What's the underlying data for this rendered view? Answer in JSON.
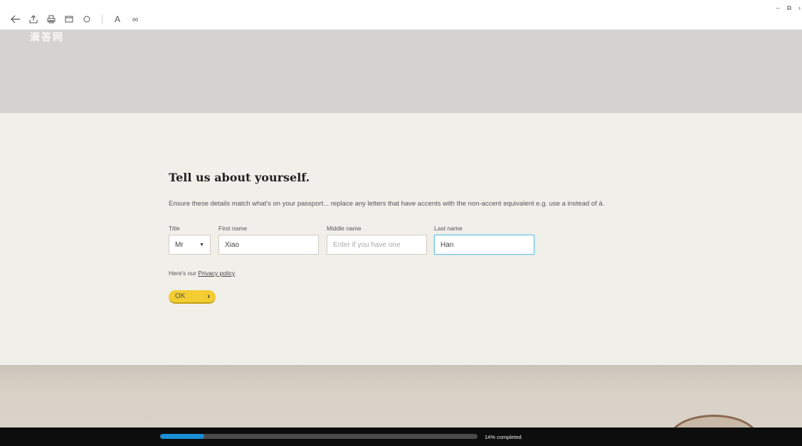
{
  "toolbar": {
    "icons": [
      "back-arrow-icon",
      "upload-icon",
      "print-icon",
      "window-icon",
      "search-icon",
      "font-icon",
      "link-icon"
    ],
    "font_label": "A",
    "link_glyph": "∞"
  },
  "watermark": "滴答网",
  "window_controls": {
    "minimize": "–",
    "restore": "⧉",
    "close": "›"
  },
  "form": {
    "heading": "Tell us about yourself.",
    "description": "Ensure these details match what's on your passport... replace any letters that have accents with the non-accent equivalent e.g. use a instead of á.",
    "title_label": "Title",
    "title_value": "Mr",
    "first_name_label": "First name",
    "first_name_value": "Xiao",
    "middle_name_label": "Middle name",
    "middle_name_placeholder": "Enter if you have one",
    "last_name_label": "Last name",
    "last_name_value": "Han",
    "privacy_prefix": "Here's our ",
    "privacy_link": "Privacy policy",
    "ok_label": "OK",
    "ok_chevron": "›"
  },
  "progress": {
    "percent": 14,
    "label": "14% completed",
    "fill_color": "#1a8ed6"
  }
}
